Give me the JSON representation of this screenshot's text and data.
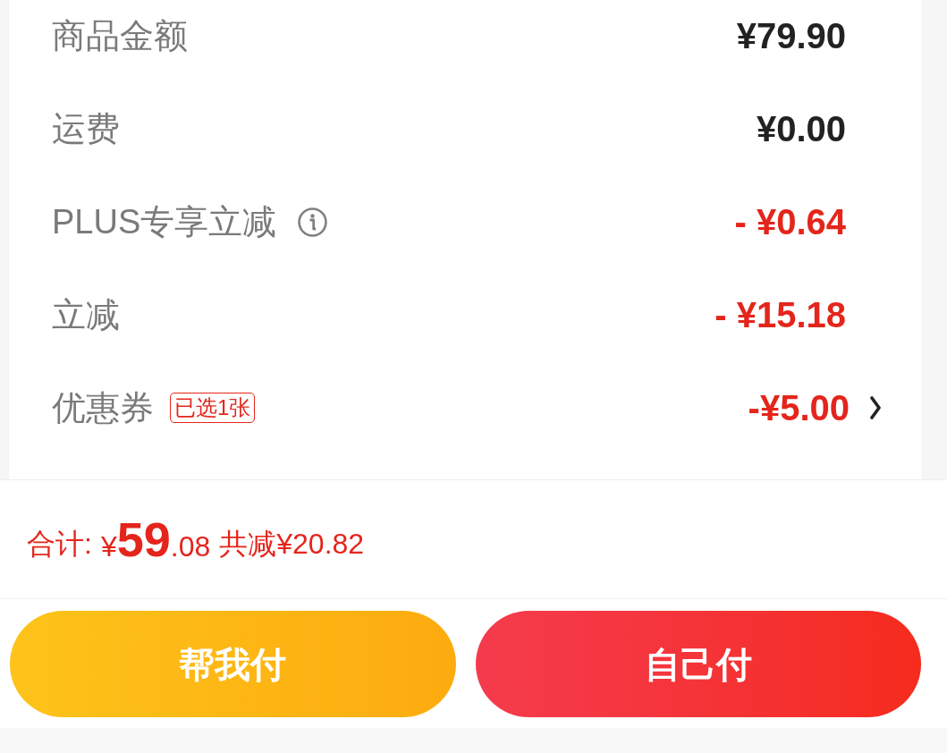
{
  "summary_rows": [
    {
      "kind": "plain",
      "label": "商品金额",
      "value": "¥79.90"
    },
    {
      "kind": "plain",
      "label": "运费",
      "value": "¥0.00"
    },
    {
      "kind": "discount",
      "label": "PLUS专享立减",
      "info": true,
      "value": "- ¥0.64"
    },
    {
      "kind": "discount",
      "label": "立减",
      "value": "- ¥15.18"
    },
    {
      "kind": "discount",
      "label": "优惠券",
      "badge": "已选1张",
      "value": "-¥5.00",
      "chevron": true
    }
  ],
  "total": {
    "label": "合计:",
    "currency": "¥",
    "integer": "59",
    "decimal": ".08",
    "saved": "共减¥20.82"
  },
  "buttons": [
    {
      "kind": "secondary",
      "label": "帮我付"
    },
    {
      "kind": "primary",
      "label": "自己付"
    }
  ]
}
